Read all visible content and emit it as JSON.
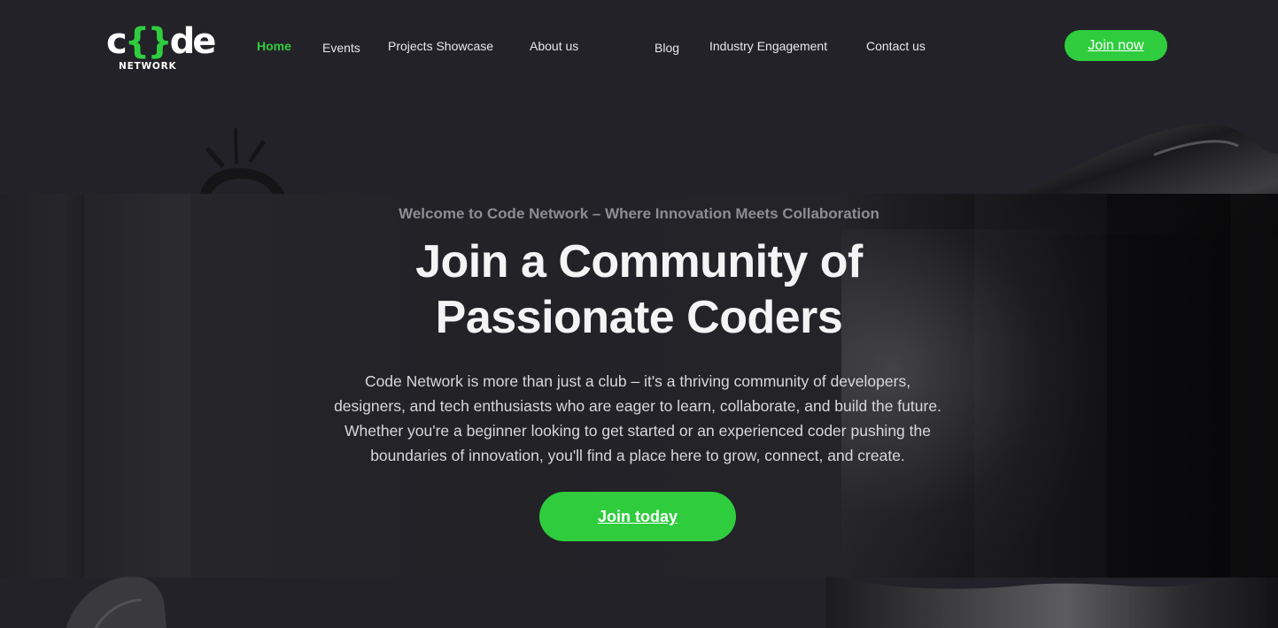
{
  "brand": {
    "logo_prefix": "c",
    "logo_brackets": "{}",
    "logo_suffix": "de",
    "logo_subtext": "NETWORK",
    "accent_color": "#2fcd3e",
    "background_color": "#232228"
  },
  "nav": {
    "items": [
      {
        "label": "Home",
        "active": true
      },
      {
        "label": "Events",
        "active": false
      },
      {
        "label": "Projects Showcase",
        "active": false
      },
      {
        "label": "About us",
        "active": false
      },
      {
        "label": "Blog",
        "active": false
      },
      {
        "label": "Industry Engagement",
        "active": false
      },
      {
        "label": "Contact us",
        "active": false
      }
    ],
    "cta_label": "Join now"
  },
  "hero": {
    "eyebrow": "Welcome to Code Network – Where Innovation Meets Collaboration",
    "title_lines": [
      "Join a Community of",
      "Passionate Coders"
    ],
    "description_lines": [
      "Code Network is more than just a club – it's a thriving community of developers,",
      "designers, and tech enthusiasts who are eager to learn, collaborate, and build the future.",
      "Whether you're a beginner looking to get started or an experienced coder pushing the",
      "boundaries of innovation, you'll find a place here to grow, connect, and create."
    ],
    "cta_label": "Join today"
  },
  "decorations": {
    "icons": [
      "sun-decoration-icon",
      "abstract-blob-shape"
    ]
  }
}
